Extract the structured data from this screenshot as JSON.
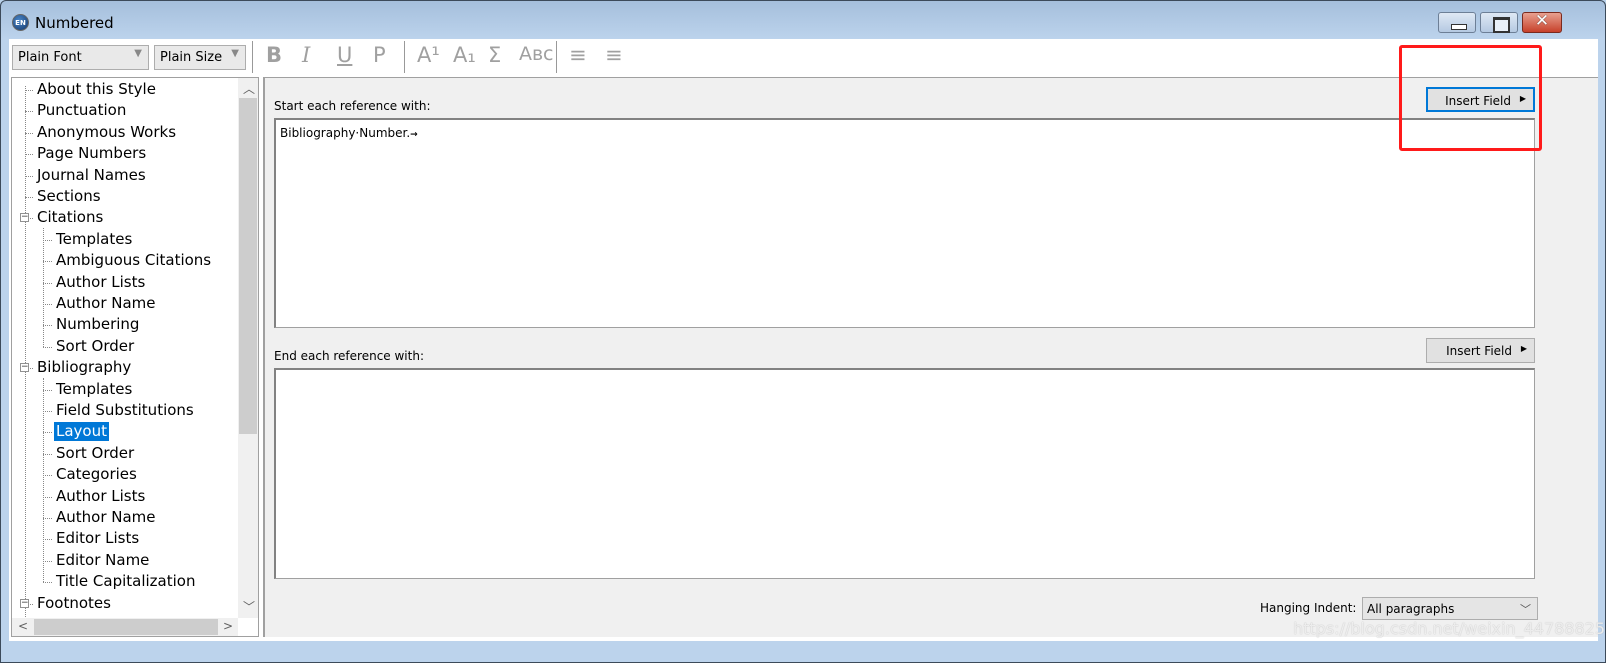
{
  "window": {
    "title": "Numbered",
    "app_icon": "EN",
    "controls": [
      "minimize",
      "maximize",
      "close"
    ]
  },
  "toolbar": {
    "font": "Plain Font",
    "size": "Plain Size",
    "buttons": [
      {
        "name": "bold",
        "glyph": "B"
      },
      {
        "name": "italic",
        "glyph": "I"
      },
      {
        "name": "underline",
        "glyph": "U"
      },
      {
        "name": "plain",
        "glyph": "P"
      },
      {
        "name": "superscript",
        "glyph": "A¹"
      },
      {
        "name": "subscript",
        "glyph": "A₁"
      },
      {
        "name": "symbol",
        "glyph": "Σ"
      },
      {
        "name": "small-caps",
        "glyph": "Aʙᴄ"
      },
      {
        "name": "align-left",
        "glyph": "≡"
      },
      {
        "name": "align-center",
        "glyph": "≡"
      }
    ]
  },
  "tree": {
    "items": [
      {
        "label": "About this Style",
        "level": 0
      },
      {
        "label": "Punctuation",
        "level": 0
      },
      {
        "label": "Anonymous Works",
        "level": 0
      },
      {
        "label": "Page Numbers",
        "level": 0
      },
      {
        "label": "Journal Names",
        "level": 0
      },
      {
        "label": "Sections",
        "level": 0
      },
      {
        "label": "Citations",
        "level": 0,
        "expanded": true
      },
      {
        "label": "Templates",
        "level": 1
      },
      {
        "label": "Ambiguous Citations",
        "level": 1
      },
      {
        "label": "Author Lists",
        "level": 1
      },
      {
        "label": "Author Name",
        "level": 1
      },
      {
        "label": "Numbering",
        "level": 1
      },
      {
        "label": "Sort Order",
        "level": 1
      },
      {
        "label": "Bibliography",
        "level": 0,
        "expanded": true
      },
      {
        "label": "Templates",
        "level": 1
      },
      {
        "label": "Field Substitutions",
        "level": 1
      },
      {
        "label": "Layout",
        "level": 1,
        "selected": true
      },
      {
        "label": "Sort Order",
        "level": 1
      },
      {
        "label": "Categories",
        "level": 1
      },
      {
        "label": "Author Lists",
        "level": 1
      },
      {
        "label": "Author Name",
        "level": 1
      },
      {
        "label": "Editor Lists",
        "level": 1
      },
      {
        "label": "Editor Name",
        "level": 1
      },
      {
        "label": "Title Capitalization",
        "level": 1
      },
      {
        "label": "Footnotes",
        "level": 0,
        "expanded": true
      }
    ]
  },
  "main": {
    "start_label": "Start each reference with:",
    "start_value": "Bibliography·Number.",
    "start_tab_mark": "→",
    "end_label": "End each reference with:",
    "end_value": "",
    "insert_field_label": "Insert Field",
    "hanging_indent_label": "Hanging Indent:",
    "hanging_indent_value": "All paragraphs"
  },
  "annotation": {
    "color": "#ff1a1a"
  },
  "watermark": "https://blog.csdn.net/weixin_44788825"
}
